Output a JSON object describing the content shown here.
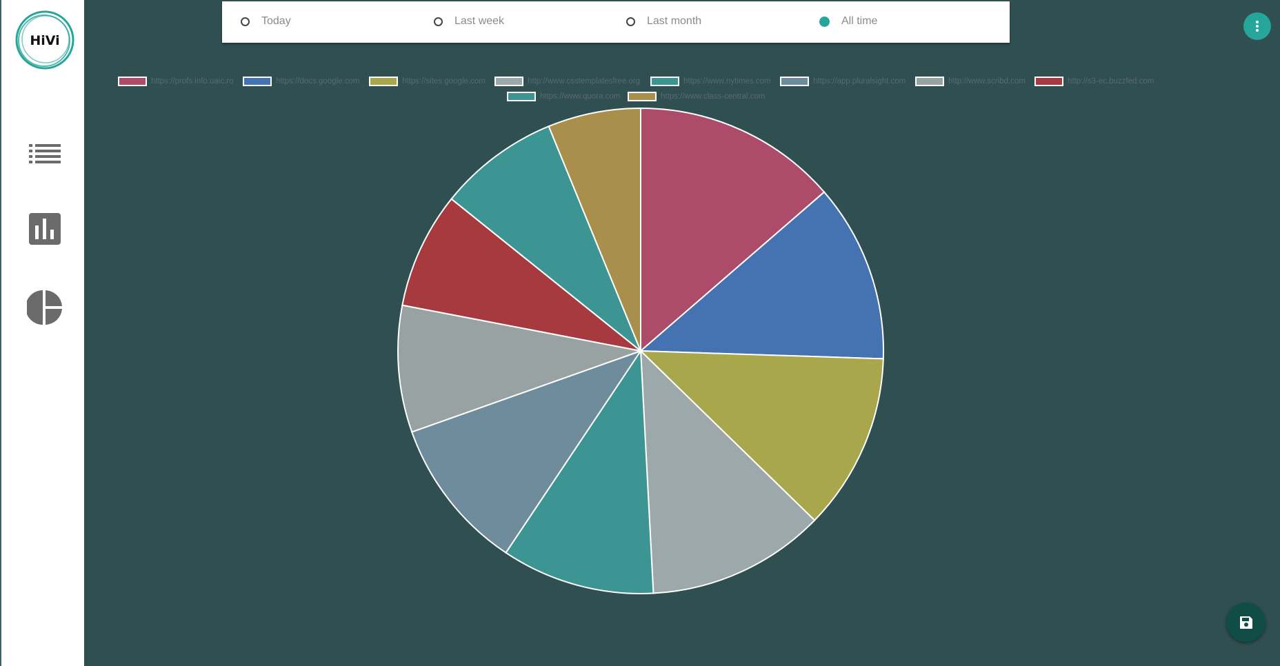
{
  "filters": [
    {
      "label": "Today",
      "checked": false
    },
    {
      "label": "Last week",
      "checked": false
    },
    {
      "label": "Last month",
      "checked": false
    },
    {
      "label": "All time",
      "checked": true
    }
  ],
  "logo_text": "HiVi",
  "sidebar": {
    "items": [
      {
        "icon": "list-icon"
      },
      {
        "icon": "bar-chart-icon"
      },
      {
        "icon": "pie-chart-icon"
      }
    ]
  },
  "colors": {
    "accent": "#26a69a",
    "background": "#2f4f50",
    "save_button": "#0f4d45"
  },
  "chart_data": {
    "type": "pie",
    "labels": [
      "https://profs.info.uaic.ro",
      "https://docs.google.com",
      "https://sites.google.com",
      "http://www.csstemplatesfree.org",
      "https://www.nytimes.com",
      "https://app.pluralsight.com",
      "http://www.scribd.com",
      "http://s3-ec.buzzfed.com",
      "https://www.quora.com",
      "https://www.class-central.com"
    ],
    "values": [
      13.9,
      12.1,
      12.0,
      12.1,
      10.4,
      10.4,
      8.6,
      7.9,
      8.2,
      6.3
    ],
    "colors": [
      "#ad4b6a",
      "#4572b0",
      "#a9a74b",
      "#9ca8aa",
      "#3d9593",
      "#6f8c9c",
      "#98a2a2",
      "#a73a3e",
      "#3d9593",
      "#a88f4b"
    ],
    "legend_position": "top"
  }
}
